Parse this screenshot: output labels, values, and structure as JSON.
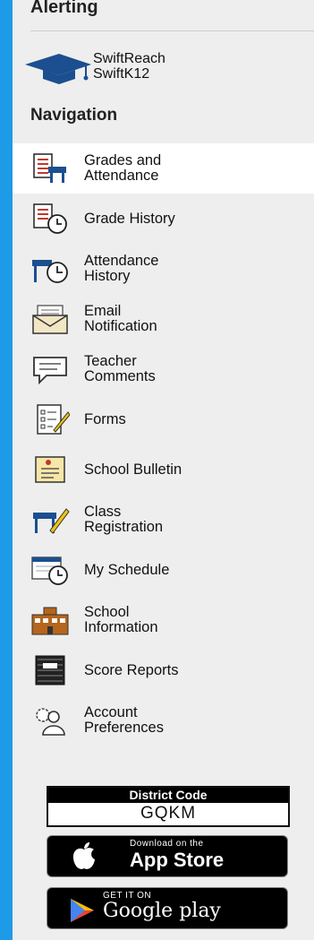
{
  "alerting": {
    "title": "Alerting",
    "item": {
      "label": "SwiftReach\nSwiftK12",
      "icon": "graduation-cap-icon"
    }
  },
  "navigation": {
    "title": "Navigation",
    "items": [
      {
        "label": "Grades and\nAttendance",
        "icon": "gradebook-icon",
        "active": true
      },
      {
        "label": "Grade History",
        "icon": "grade-history-icon"
      },
      {
        "label": "Attendance\nHistory",
        "icon": "attendance-history-icon"
      },
      {
        "label": "Email\nNotification",
        "icon": "envelope-icon"
      },
      {
        "label": "Teacher\nComments",
        "icon": "speech-bubble-icon"
      },
      {
        "label": "Forms",
        "icon": "form-pencil-icon"
      },
      {
        "label": "School Bulletin",
        "icon": "bulletin-icon"
      },
      {
        "label": "Class\nRegistration",
        "icon": "desk-pencil-icon"
      },
      {
        "label": "My Schedule",
        "icon": "schedule-clock-icon"
      },
      {
        "label": "School\nInformation",
        "icon": "school-building-icon"
      },
      {
        "label": "Score Reports",
        "icon": "notebook-icon"
      },
      {
        "label": "Account\nPreferences",
        "icon": "user-gear-icon"
      }
    ]
  },
  "district_code": {
    "label": "District Code",
    "value": "GQKM"
  },
  "app_store": {
    "small": "Download on the",
    "big": "App Store"
  },
  "google_play": {
    "small": "GET IT ON",
    "big": "Google play"
  },
  "colors": {
    "accent": "#1e9be6",
    "panel": "#eeeeee",
    "active": "#ffffff"
  }
}
